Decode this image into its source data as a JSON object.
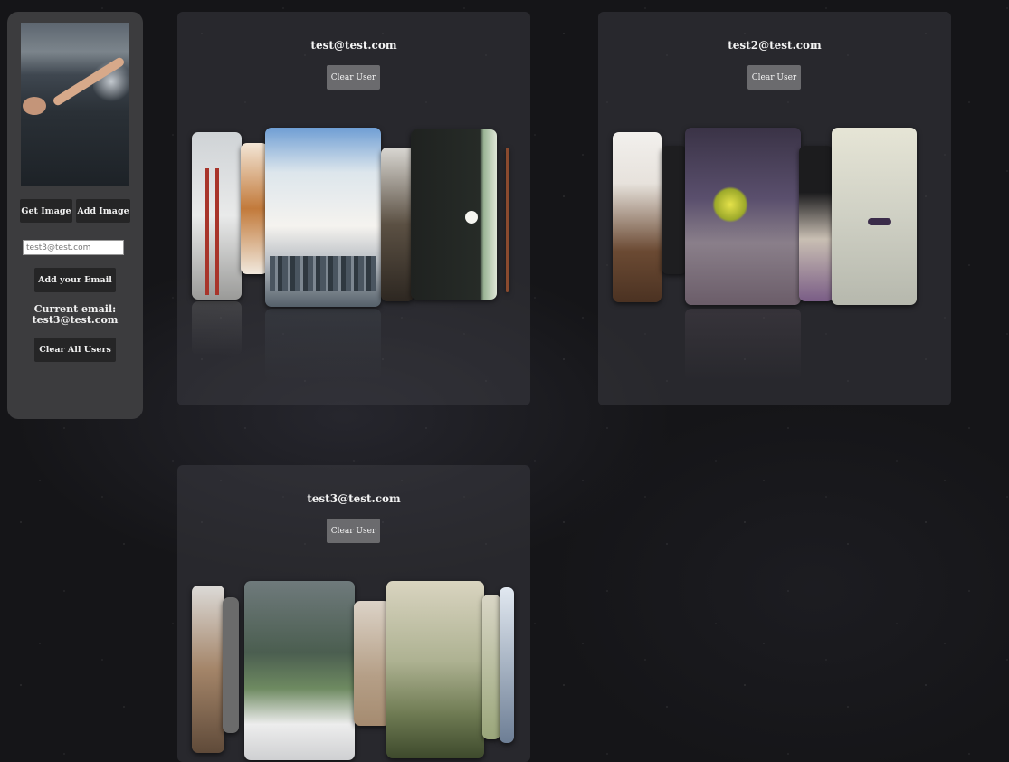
{
  "sidebar": {
    "get_image_label": "Get Image",
    "add_image_label": "Add Image",
    "email_input_value": "test3@test.com",
    "add_email_label": "Add your Email",
    "current_email_heading": "Current email:",
    "current_email_value": "test3@test.com",
    "clear_all_label": "Clear All Users"
  },
  "users": [
    {
      "email": "test@test.com",
      "clear_label": "Clear User"
    },
    {
      "email": "test2@test.com",
      "clear_label": "Clear User"
    },
    {
      "email": "test3@test.com",
      "clear_label": "Clear User"
    }
  ]
}
